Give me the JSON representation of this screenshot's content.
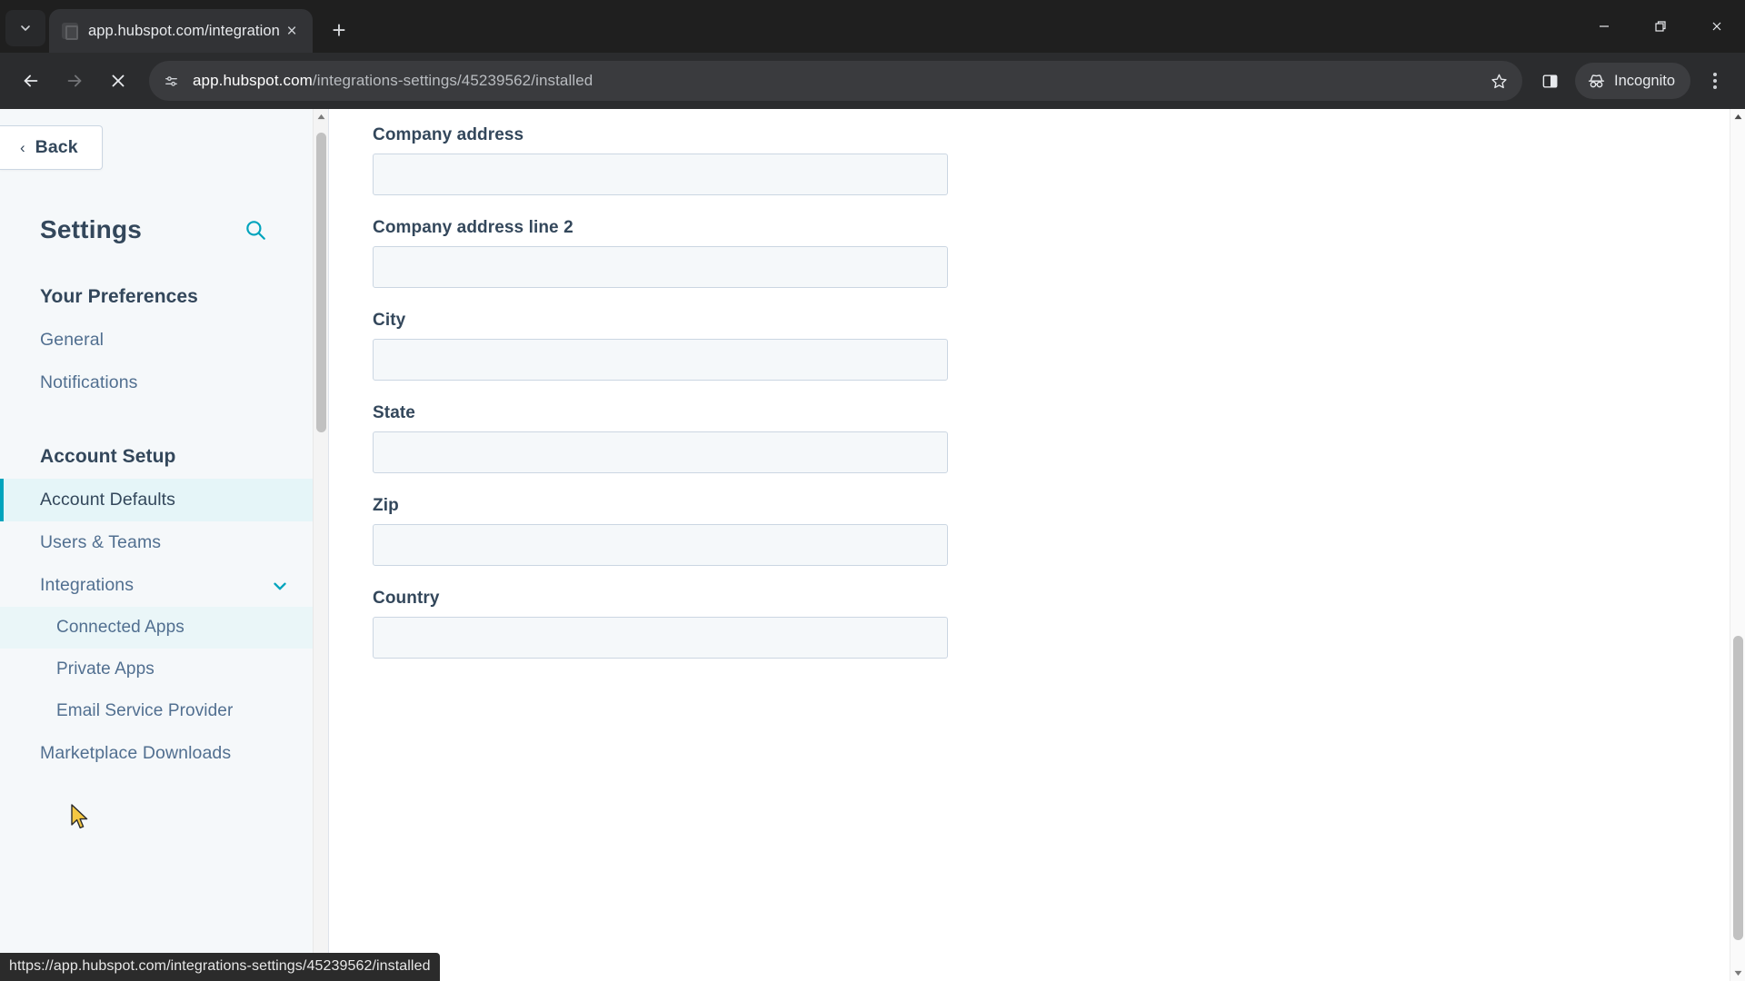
{
  "browser": {
    "tab": {
      "title": "app.hubspot.com/integrations-",
      "favicon": "hubspot-favicon",
      "close_label": "×"
    },
    "new_tab_label": "+",
    "tab_search_icon": "chevron-down-icon",
    "window_controls": {
      "minimize": "minimize-icon",
      "maximize": "restore-icon",
      "close": "close-icon"
    },
    "toolbar": {
      "back_icon": "arrow-left-icon",
      "forward_icon": "arrow-right-icon",
      "stop_icon": "stop-loading-icon",
      "site_settings_icon": "tune-icon",
      "url_host": "app.hubspot.com",
      "url_path": "/integrations-settings/45239562/installed",
      "url_full": "app.hubspot.com/integrations-settings/45239562/installed",
      "bookmark_icon": "star-icon",
      "side_panel_icon": "side-panel-icon",
      "incognito_label": "Incognito",
      "incognito_icon": "incognito-icon",
      "menu_icon": "kebab-menu-icon"
    },
    "status_bar_url": "https://app.hubspot.com/integrations-settings/45239562/installed"
  },
  "sidebar": {
    "back_label": "Back",
    "back_icon": "chevron-left-icon",
    "title": "Settings",
    "search_icon": "search-icon",
    "sections": [
      {
        "title": "Your Preferences",
        "items": [
          {
            "label": "General",
            "state": "default",
            "level": "top"
          },
          {
            "label": "Notifications",
            "state": "default",
            "level": "top"
          }
        ]
      },
      {
        "title": "Account Setup",
        "items": [
          {
            "label": "Account Defaults",
            "state": "active",
            "level": "top"
          },
          {
            "label": "Users & Teams",
            "state": "default",
            "level": "top"
          },
          {
            "label": "Integrations",
            "state": "expanded",
            "level": "top",
            "chevron": "chevron-down-icon"
          },
          {
            "label": "Connected Apps",
            "state": "hover",
            "level": "sub"
          },
          {
            "label": "Private Apps",
            "state": "default",
            "level": "sub"
          },
          {
            "label": "Email Service Provider",
            "state": "default",
            "level": "sub"
          },
          {
            "label": "Marketplace Downloads",
            "state": "default",
            "level": "top"
          }
        ]
      }
    ],
    "scrollbar": {
      "up_icon": "scroll-up-arrow",
      "down_icon": "scroll-down-arrow"
    }
  },
  "main": {
    "fields": [
      {
        "label": "Company address",
        "value": "",
        "placeholder": ""
      },
      {
        "label": "Company address line 2",
        "value": "",
        "placeholder": ""
      },
      {
        "label": "City",
        "value": "",
        "placeholder": ""
      },
      {
        "label": "State",
        "value": "",
        "placeholder": ""
      },
      {
        "label": "Zip",
        "value": "",
        "placeholder": ""
      },
      {
        "label": "Country",
        "value": "",
        "placeholder": ""
      }
    ],
    "scrollbar": {
      "up_icon": "scroll-up-arrow",
      "down_icon": "scroll-down-arrow"
    }
  },
  "colors": {
    "accent_teal": "#00a4bd",
    "active_bg": "#e5f5f8",
    "hover_bg": "#eaf6f8",
    "text_dark": "#33475b",
    "text_muted": "#516f90",
    "sidebar_bg": "#f5f8fa",
    "input_bg": "#f5f8fa",
    "input_border": "#cbd6e2",
    "chrome_bg": "#2b2c2e"
  }
}
